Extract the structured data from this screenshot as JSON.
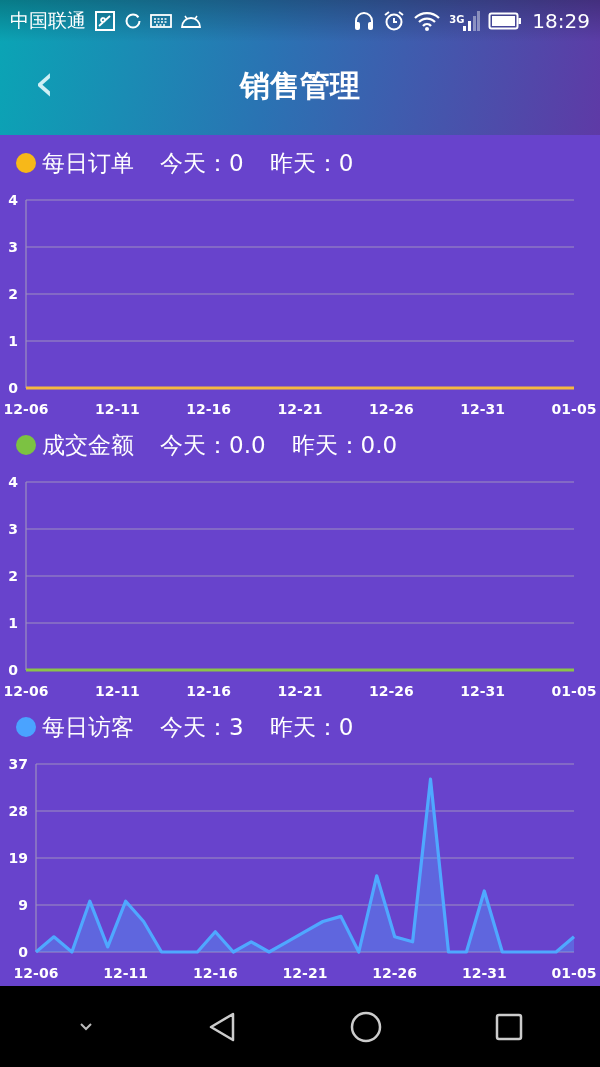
{
  "status_bar": {
    "carrier": "中国联通",
    "network_type": "3G",
    "time": "18:29"
  },
  "header": {
    "back": "‹",
    "title": "销售管理"
  },
  "charts": [
    {
      "title": "每日订单",
      "color": "#f7b819",
      "today": "今天：0",
      "yesterday": "昨天：0",
      "chart_data": {
        "type": "line",
        "categories": [
          "12-06",
          null,
          null,
          null,
          null,
          "12-11",
          null,
          null,
          null,
          null,
          "12-16",
          null,
          null,
          null,
          null,
          "12-21",
          null,
          null,
          null,
          null,
          "12-26",
          null,
          null,
          null,
          null,
          "12-31",
          null,
          null,
          null,
          null,
          "01-05"
        ],
        "series": [
          {
            "color": "#f5b840",
            "values": [
              0,
              0,
              0,
              0,
              0,
              0,
              0,
              0,
              0,
              0,
              0,
              0,
              0,
              0,
              0,
              0,
              0,
              0,
              0,
              0,
              0,
              0,
              0,
              0,
              0,
              0,
              0,
              0,
              0,
              0,
              0
            ]
          }
        ],
        "grid": true,
        "ylim": [
          0,
          4
        ],
        "yticks": [
          0,
          1,
          2,
          3,
          4
        ]
      }
    },
    {
      "title": "成交金额",
      "color": "#7cc242",
      "today": "今天：0.0",
      "yesterday": "昨天：0.0",
      "chart_data": {
        "type": "line",
        "categories": [
          "12-06",
          null,
          null,
          null,
          null,
          "12-11",
          null,
          null,
          null,
          null,
          "12-16",
          null,
          null,
          null,
          null,
          "12-21",
          null,
          null,
          null,
          null,
          "12-26",
          null,
          null,
          null,
          null,
          "12-31",
          null,
          null,
          null,
          null,
          "01-05"
        ],
        "series": [
          {
            "color": "#8bc34a",
            "values": [
              0,
              0,
              0,
              0,
              0,
              0,
              0,
              0,
              0,
              0,
              0,
              0,
              0,
              0,
              0,
              0,
              0,
              0,
              0,
              0,
              0,
              0,
              0,
              0,
              0,
              0,
              0,
              0,
              0,
              0,
              0
            ]
          }
        ],
        "grid": true,
        "ylim": [
          0,
          4
        ],
        "yticks": [
          0,
          1,
          2,
          3,
          4
        ]
      }
    },
    {
      "title": "每日访客",
      "color": "#4aa3ff",
      "today": "今天：3",
      "yesterday": "昨天：0",
      "chart_data": {
        "type": "area",
        "categories": [
          "12-06",
          null,
          null,
          null,
          null,
          "12-11",
          null,
          null,
          null,
          null,
          "12-16",
          null,
          null,
          null,
          null,
          "12-21",
          null,
          null,
          null,
          null,
          "12-26",
          null,
          null,
          null,
          null,
          "12-31",
          null,
          null,
          null,
          null,
          "01-05"
        ],
        "series": [
          {
            "color": "#4fa8ff",
            "values": [
              0,
              3,
              0,
              10,
              1,
              10,
              6,
              0,
              0,
              0,
              4,
              0,
              2,
              0,
              2,
              4,
              6,
              7,
              0,
              15,
              3,
              2,
              34,
              0,
              0,
              12,
              0,
              0,
              0,
              0,
              3
            ]
          }
        ],
        "grid": true,
        "ylim": [
          0,
          37
        ],
        "yticks": [
          0,
          {
            "value": 9.25,
            "label": "9"
          },
          {
            "value": 18.5,
            "label": "19"
          },
          {
            "value": 27.75,
            "label": "28"
          },
          37
        ]
      }
    }
  ]
}
